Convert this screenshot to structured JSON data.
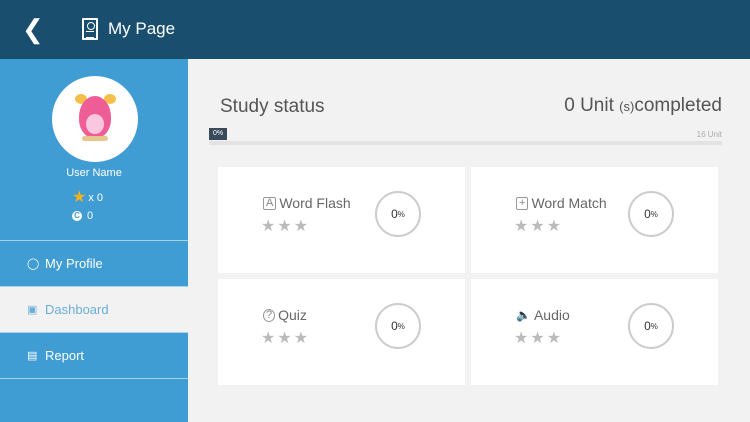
{
  "header": {
    "title": "My Page",
    "back_icon": "chevron-left-icon"
  },
  "profile": {
    "user_name": "User Name",
    "stars": "x 0",
    "coins": "0",
    "coin_glyph": "C"
  },
  "nav": [
    {
      "label": "My Profile"
    },
    {
      "label": "Dashboard"
    },
    {
      "label": "Report"
    }
  ],
  "study": {
    "title": "Study status",
    "completed_count": "0 Unit",
    "completed_suffix": "(s)",
    "completed_word": "completed",
    "progress_label": "0%",
    "progress": 0,
    "total": "16 Unit"
  },
  "cards": [
    {
      "label": "Word Flash",
      "percent": "0",
      "unit": "%",
      "stars": "★★★"
    },
    {
      "label": "Word Match",
      "percent": "0",
      "unit": "%",
      "stars": "★★★"
    },
    {
      "label": "Quiz",
      "percent": "0",
      "unit": "%",
      "stars": "★★★"
    },
    {
      "label": "Audio",
      "percent": "0",
      "unit": "%",
      "stars": "★★★"
    }
  ],
  "colors": {
    "header": "#1a4e6e",
    "sidebar": "#3f9dd4",
    "background": "#f2f2f2"
  }
}
